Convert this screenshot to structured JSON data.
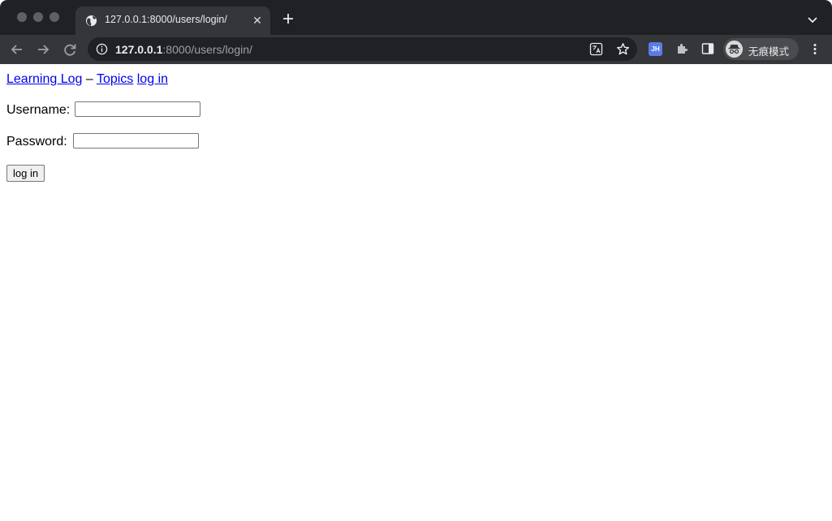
{
  "browser": {
    "tab": {
      "title": "127.0.0.1:8000/users/login/"
    },
    "address": {
      "host": "127.0.0.1",
      "path": ":8000/users/login/"
    },
    "extension_badge": "JH",
    "incognito_label": "无痕模式",
    "colors": {
      "tabbar": "#202124",
      "toolbar": "#35363a",
      "omnibox": "#202124",
      "link": "#0000ee"
    }
  },
  "nav": {
    "home_link": "Learning Log",
    "separator": "–",
    "topics_link": "Topics",
    "login_link": "log in"
  },
  "form": {
    "username_label": "Username:",
    "username_value": "",
    "password_label": "Password:",
    "password_value": "",
    "submit_label": "log in"
  }
}
